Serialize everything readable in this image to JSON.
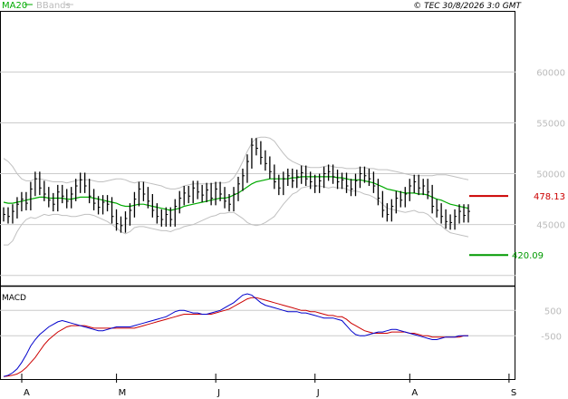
{
  "header": {
    "legend_ma": "MA20",
    "legend_bb": "BBands",
    "copyright": "© TEC 30/8/2026 3:0 GMT"
  },
  "colors": {
    "price": "#000000",
    "ma": "#00aa00",
    "bbands": "#c0c0c0",
    "resistance": "#cc0000",
    "support": "#009900",
    "macd": "#0000cc",
    "signal": "#cc0000",
    "grid": "#cccccc",
    "frame": "#000000"
  },
  "chart_data": [
    {
      "type": "line",
      "name": "price-panel",
      "y_ticks": [
        60000,
        55000,
        50000,
        45000
      ],
      "y_tick_labels": [
        "60000",
        "55000",
        "50000",
        "45000"
      ],
      "ylim": [
        39000,
        66000
      ],
      "x_month_labels": [
        "A",
        "M",
        "J",
        "J",
        "A",
        "S"
      ],
      "x_month_positions": [
        0,
        21,
        43,
        65,
        86,
        108
      ],
      "x_count": 104,
      "resistance": {
        "value": 47813,
        "label": "478.13"
      },
      "support": {
        "value": 42009,
        "label": "420.09"
      },
      "close": [
        46000,
        45800,
        46300,
        47000,
        47500,
        47100,
        48500,
        49500,
        48600,
        48000,
        47400,
        47000,
        48200,
        47800,
        47300,
        48000,
        48800,
        49400,
        48800,
        47800,
        47100,
        46700,
        47200,
        47000,
        45800,
        45100,
        44900,
        45600,
        46400,
        47500,
        48500,
        48000,
        47300,
        46400,
        45800,
        45500,
        46000,
        45500,
        46800,
        47600,
        48100,
        47800,
        48600,
        48200,
        47900,
        48400,
        47600,
        48500,
        48000,
        47300,
        47000,
        48000,
        49000,
        49800,
        51200,
        52800,
        52500,
        51600,
        51000,
        50200,
        49200,
        48600,
        49500,
        49800,
        49300,
        49700,
        50100,
        49500,
        49200,
        48800,
        49300,
        50000,
        50200,
        49700,
        49200,
        49400,
        48800,
        48500,
        49300,
        50000,
        49800,
        49500,
        48800,
        47600,
        46400,
        46000,
        46800,
        47600,
        47400,
        48000,
        48800,
        49200,
        48600,
        48800,
        48200,
        46800,
        46400,
        45800,
        45300,
        45200,
        45800,
        46300,
        45900,
        46300
      ],
      "ma20": [
        47200,
        47100,
        47100,
        47200,
        47300,
        47400,
        47500,
        47600,
        47700,
        47700,
        47600,
        47600,
        47600,
        47600,
        47500,
        47500,
        47600,
        47700,
        47700,
        47700,
        47600,
        47500,
        47400,
        47300,
        47200,
        47100,
        46900,
        46800,
        46800,
        46900,
        47000,
        47000,
        46900,
        46800,
        46700,
        46600,
        46500,
        46400,
        46500,
        46600,
        46800,
        46900,
        47000,
        47100,
        47200,
        47300,
        47400,
        47500,
        47600,
        47600,
        47700,
        47900,
        48100,
        48400,
        48700,
        49000,
        49200,
        49300,
        49400,
        49500,
        49500,
        49500,
        49500,
        49500,
        49600,
        49600,
        49700,
        49700,
        49700,
        49700,
        49700,
        49700,
        49700,
        49700,
        49600,
        49600,
        49500,
        49400,
        49400,
        49400,
        49300,
        49200,
        49100,
        48900,
        48700,
        48500,
        48400,
        48300,
        48200,
        48100,
        48100,
        48100,
        48000,
        48000,
        47900,
        47700,
        47500,
        47400,
        47200,
        47000,
        46900,
        46800,
        46700,
        46600
      ],
      "bb_upper": [
        51500,
        51200,
        50700,
        50000,
        49500,
        49300,
        49300,
        49500,
        49500,
        49400,
        49300,
        49200,
        49200,
        49200,
        49100,
        49200,
        49300,
        49400,
        49400,
        49400,
        49300,
        49200,
        49200,
        49300,
        49400,
        49500,
        49500,
        49400,
        49200,
        49100,
        49200,
        49200,
        49100,
        49000,
        48900,
        48800,
        48600,
        48500,
        48500,
        48600,
        48800,
        48900,
        49000,
        49000,
        49000,
        49000,
        49000,
        49100,
        49100,
        49100,
        49200,
        49600,
        50300,
        51200,
        52200,
        53000,
        53500,
        53600,
        53600,
        53500,
        53200,
        52600,
        52000,
        51500,
        51200,
        51000,
        50800,
        50700,
        50600,
        50600,
        50600,
        50700,
        50800,
        50700,
        50600,
        50600,
        50500,
        50500,
        50500,
        50600,
        50600,
        50500,
        50500,
        50400,
        50400,
        50400,
        50300,
        50200,
        50100,
        50000,
        49900,
        49800,
        49800,
        49800,
        49800,
        49800,
        49900,
        49900,
        49900,
        49800,
        49700,
        49600,
        49500,
        49400
      ],
      "bb_lower": [
        43000,
        43000,
        43400,
        44300,
        45000,
        45500,
        45700,
        45600,
        45800,
        46000,
        45900,
        46000,
        46000,
        45900,
        45900,
        45800,
        45800,
        45900,
        46000,
        46000,
        45900,
        45700,
        45500,
        45300,
        45000,
        44700,
        44300,
        44100,
        44300,
        44700,
        44800,
        44800,
        44700,
        44600,
        44500,
        44400,
        44400,
        44300,
        44500,
        44600,
        44800,
        44900,
        45000,
        45200,
        45400,
        45600,
        45800,
        45900,
        46100,
        46100,
        46200,
        46200,
        45900,
        45600,
        45200,
        45000,
        44900,
        45000,
        45200,
        45500,
        45800,
        46400,
        47000,
        47500,
        48000,
        48200,
        48600,
        48700,
        48800,
        48800,
        48800,
        48700,
        48600,
        48700,
        48600,
        48600,
        48500,
        48300,
        48300,
        48200,
        48000,
        47900,
        47700,
        47400,
        47000,
        46600,
        46500,
        46400,
        46300,
        46200,
        46300,
        46400,
        46200,
        46200,
        46000,
        45600,
        45100,
        44900,
        44500,
        44200,
        44100,
        44000,
        43900,
        43800
      ]
    },
    {
      "type": "line",
      "name": "macd-panel",
      "title": "MACD",
      "y_ticks": [
        500,
        -500
      ],
      "y_tick_labels": [
        "500",
        "-500"
      ],
      "ylim": [
        -2200,
        1400
      ],
      "macd": [
        -2100,
        -2050,
        -1950,
        -1800,
        -1550,
        -1250,
        -900,
        -650,
        -450,
        -300,
        -150,
        -50,
        50,
        100,
        50,
        0,
        -50,
        -100,
        -150,
        -200,
        -250,
        -300,
        -300,
        -250,
        -200,
        -150,
        -150,
        -150,
        -150,
        -100,
        -50,
        0,
        50,
        100,
        150,
        200,
        250,
        350,
        450,
        500,
        500,
        450,
        400,
        400,
        350,
        350,
        400,
        450,
        500,
        600,
        700,
        800,
        950,
        1100,
        1150,
        1100,
        950,
        800,
        700,
        650,
        600,
        550,
        500,
        450,
        450,
        450,
        400,
        400,
        350,
        300,
        250,
        200,
        200,
        200,
        150,
        100,
        -100,
        -300,
        -450,
        -500,
        -500,
        -450,
        -400,
        -350,
        -350,
        -300,
        -250,
        -250,
        -300,
        -350,
        -400,
        -450,
        -500,
        -550,
        -600,
        -650,
        -650,
        -600,
        -550,
        -550,
        -550,
        -500,
        -500,
        -500
      ],
      "signal": [
        -2100,
        -2080,
        -2050,
        -2000,
        -1900,
        -1750,
        -1550,
        -1350,
        -1100,
        -850,
        -650,
        -500,
        -350,
        -250,
        -150,
        -100,
        -100,
        -100,
        -100,
        -150,
        -200,
        -200,
        -200,
        -200,
        -200,
        -200,
        -200,
        -200,
        -200,
        -200,
        -150,
        -100,
        -50,
        0,
        50,
        100,
        150,
        200,
        250,
        300,
        350,
        350,
        350,
        350,
        350,
        350,
        350,
        400,
        450,
        500,
        550,
        650,
        750,
        850,
        950,
        1000,
        1000,
        950,
        900,
        850,
        800,
        750,
        700,
        650,
        600,
        550,
        500,
        500,
        450,
        450,
        400,
        350,
        300,
        300,
        250,
        250,
        150,
        0,
        -100,
        -200,
        -300,
        -350,
        -400,
        -400,
        -400,
        -400,
        -350,
        -350,
        -350,
        -350,
        -400,
        -400,
        -450,
        -500,
        -500,
        -550,
        -550,
        -550,
        -550,
        -550,
        -550,
        -550,
        -500,
        -500
      ]
    }
  ]
}
